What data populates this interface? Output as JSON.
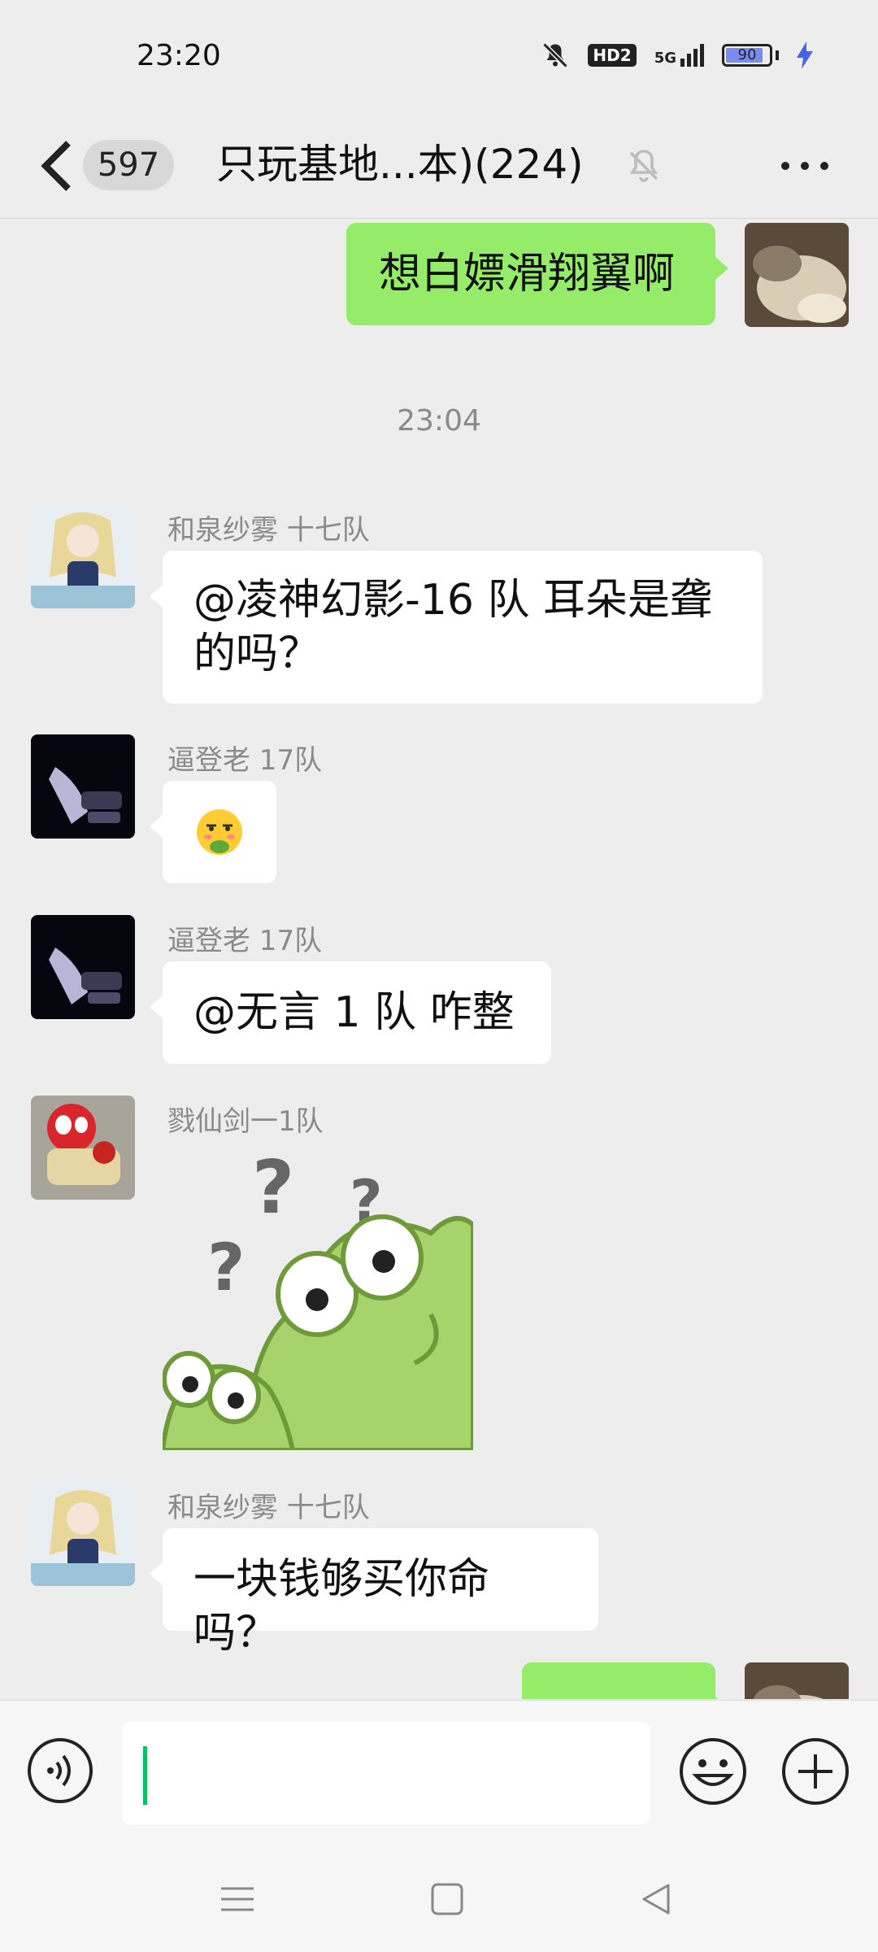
{
  "status_bar": {
    "time": "23:20",
    "hd": "HD2",
    "network": "5G",
    "battery": "90"
  },
  "header": {
    "unread_count": "597",
    "title": "只玩基地...本)(224)"
  },
  "messages": {
    "m1": {
      "text": "想白嫖滑翔翼啊"
    },
    "ts1": "23:04",
    "m2": {
      "sender": "和泉纱雾 十七队",
      "text": "@凌神幻影-16 队  耳朵是聋的吗？"
    },
    "m3": {
      "sender": "逼登老  17队"
    },
    "m4": {
      "sender": "逼登老  17队",
      "text": "@无言 1 队  咋整"
    },
    "m5": {
      "sender": "戮仙剑一1队"
    },
    "m6": {
      "sender": "和泉纱雾 十七队",
      "text": "一块钱够买你命吗？"
    }
  },
  "colors": {
    "my_bubble": "#95ec69",
    "background": "#ededed",
    "caret": "#07c160"
  }
}
